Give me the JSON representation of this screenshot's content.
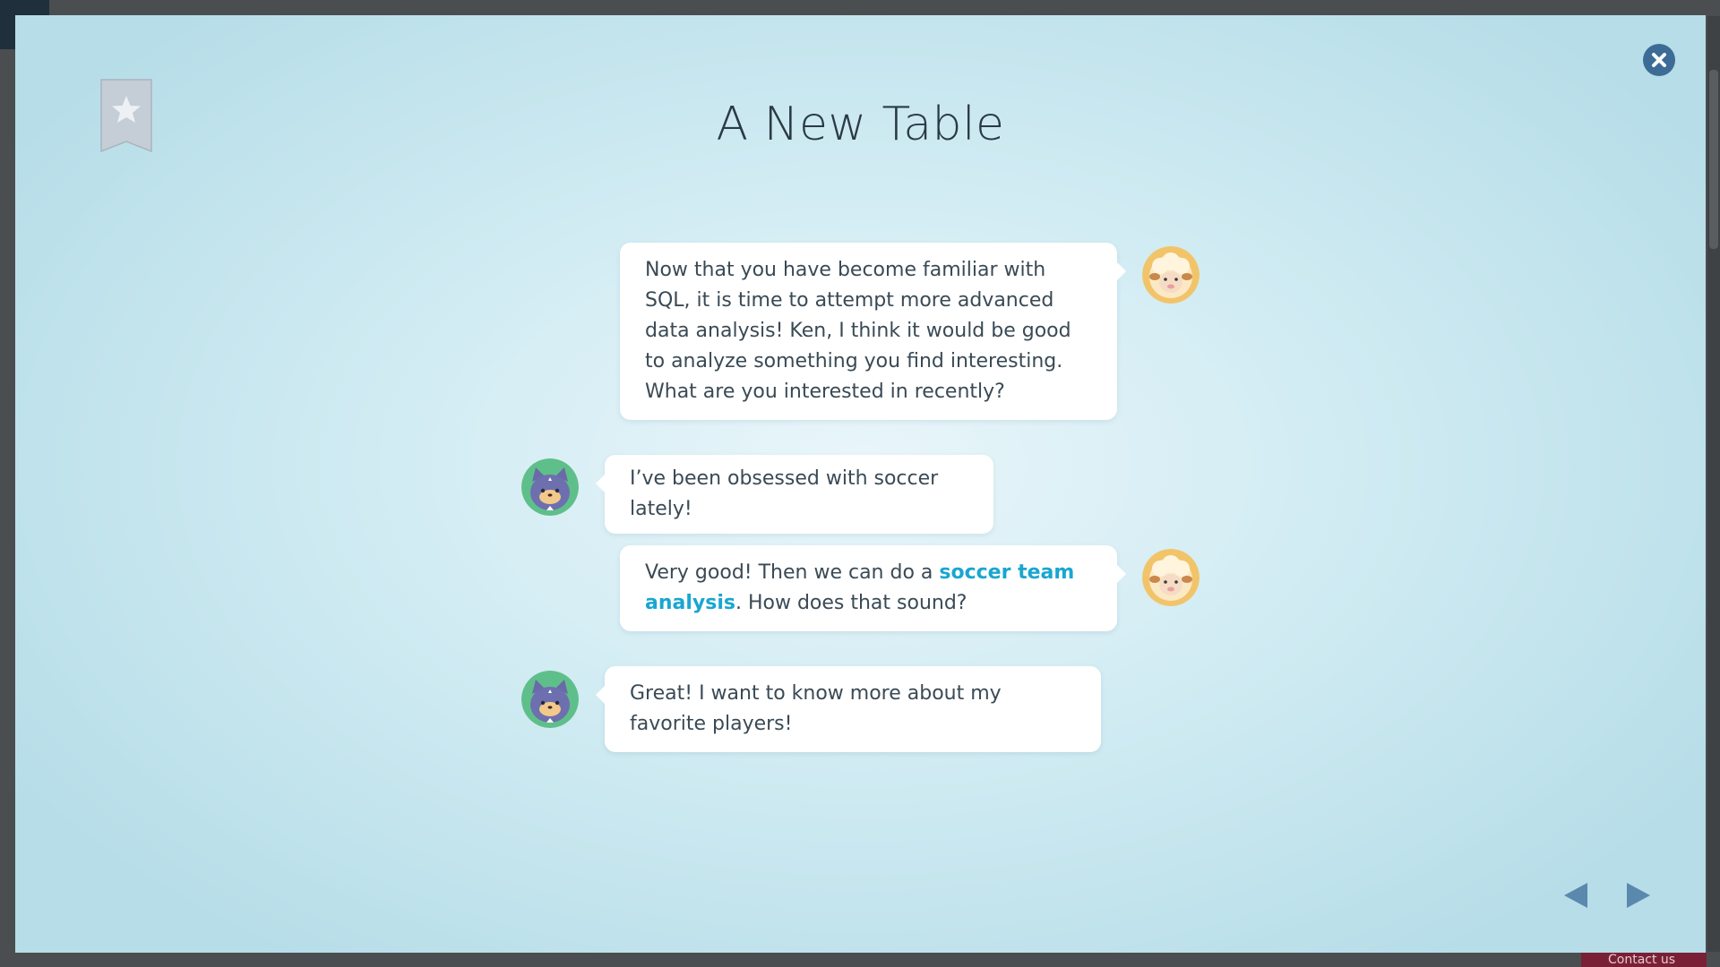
{
  "dialog": {
    "title": "A New Table"
  },
  "messages": [
    {
      "speaker": "sheep",
      "text": "Now that you have become familiar with SQL, it is time to attempt more advanced data analysis! Ken, I think it would be good to analyze something you find interesting. What are you interested in recently?"
    },
    {
      "speaker": "cat",
      "text": "I’ve been obsessed with soccer lately!"
    },
    {
      "speaker": "sheep",
      "text_before": "Very good! Then we can do a ",
      "highlight": "soccer team analysis",
      "text_after": ". How does that sound?"
    },
    {
      "speaker": "cat",
      "text": "Great! I want to know more about my favorite players!"
    }
  ],
  "icons": {
    "close": "close-icon",
    "bookmark": "bookmark-star-icon",
    "prev": "triangle-left-icon",
    "next": "triangle-right-icon",
    "sheep_avatar": "sheep-avatar",
    "cat_avatar": "cat-avatar"
  },
  "backdrop": {
    "contact_label": "Contact us"
  },
  "colors": {
    "highlight": "#1aa6d0",
    "close_button": "#3c6c96",
    "nav_arrow": "#5b88ad",
    "title_text": "#2a3a45",
    "body_text": "#3a4a55"
  }
}
